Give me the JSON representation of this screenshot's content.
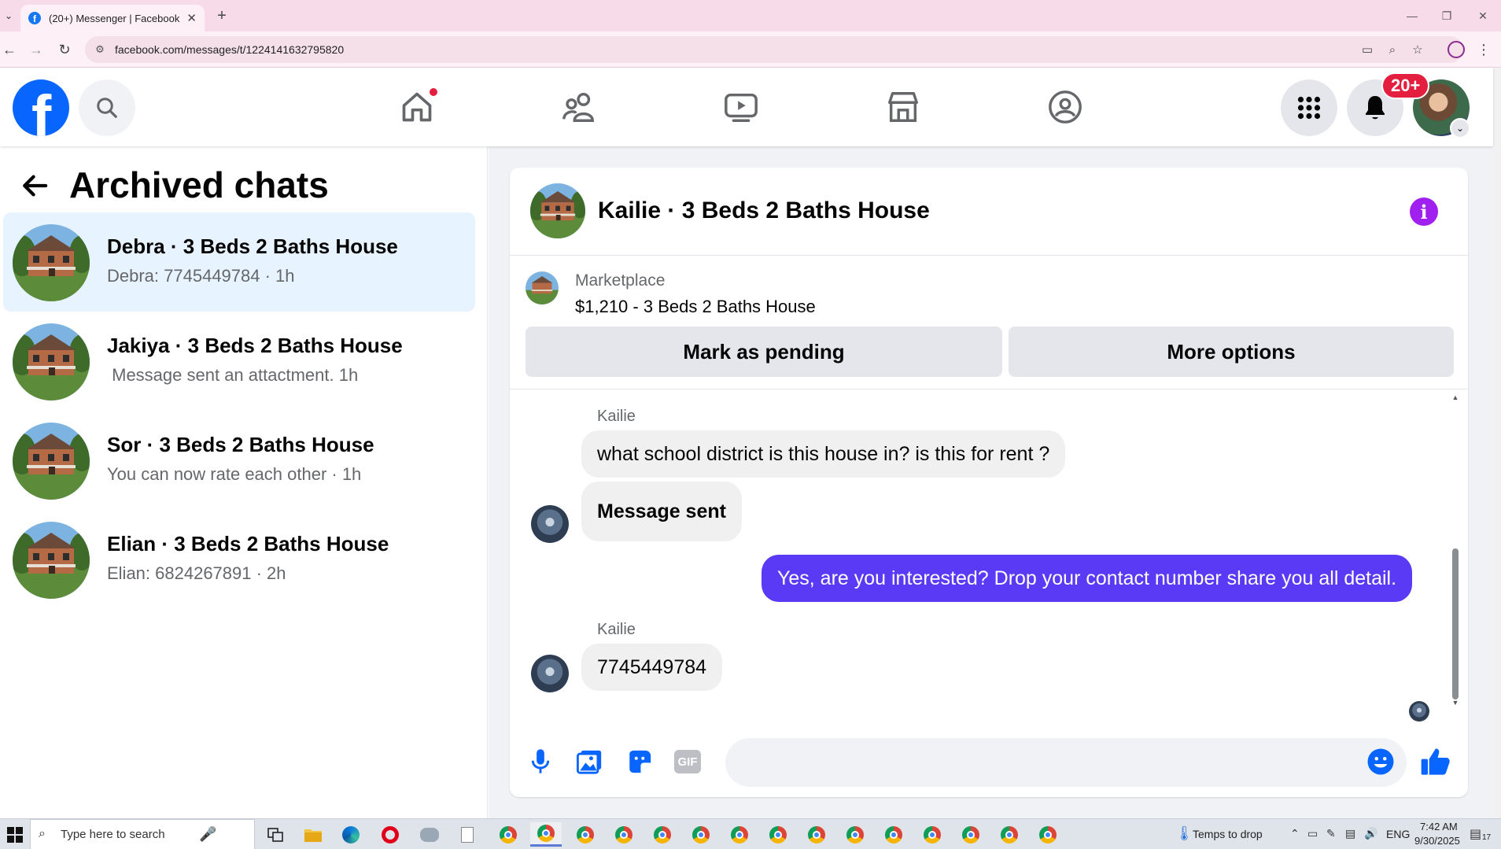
{
  "browser": {
    "tab_title": "(20+) Messenger | Facebook",
    "tab_close": "✕",
    "new_tab": "+",
    "url": "facebook.com/messages/t/1224141632795820",
    "win_min": "—",
    "win_restore": "❐",
    "win_close": "✕"
  },
  "header": {
    "notification_count": "20+",
    "logo_letter": "f"
  },
  "left_panel": {
    "title": "Archived chats",
    "chats": [
      {
        "name": "Debra · 3 Beds 2 Baths House",
        "preview": "Debra: 7745449784 · 1h"
      },
      {
        "name": "Jakiya · 3 Beds 2 Baths House",
        "preview": " Message sent an attactment. 1h"
      },
      {
        "name": "Sor · 3 Beds 2 Baths House",
        "preview": "You can now rate each other · 1h"
      },
      {
        "name": "Elian · 3 Beds 2 Baths House",
        "preview": "Elian: 6824267891 · 2h"
      }
    ]
  },
  "conversation": {
    "title": "Kailie · 3 Beds 2 Baths House",
    "marketplace_label": "Marketplace",
    "listing": "$1,210 - 3 Beds 2 Baths House",
    "mark_pending_label": "Mark as pending",
    "more_options_label": "More options",
    "messages": [
      {
        "sender": "Kailie",
        "text": "what school district is this house in? is this for rent ?"
      },
      {
        "text": "Message sent"
      },
      {
        "text": "Yes, are you interested? Drop your contact  number share you all detail."
      },
      {
        "sender": "Kailie",
        "text": "7745449784"
      }
    ],
    "composer_placeholder": "",
    "gif_label": "GIF"
  },
  "taskbar": {
    "search_placeholder": "Type here to search",
    "weather": "Temps to drop",
    "language": "ENG",
    "time": "7:42 AM",
    "date": "9/30/2025",
    "notif_count": "17"
  },
  "colors": {
    "fb_blue": "#0866ff",
    "outgoing_bubble": "#5b3af5",
    "active_chat": "#e7f3ff",
    "badge_red": "#e41e3f",
    "info_purple": "#a020f0"
  }
}
